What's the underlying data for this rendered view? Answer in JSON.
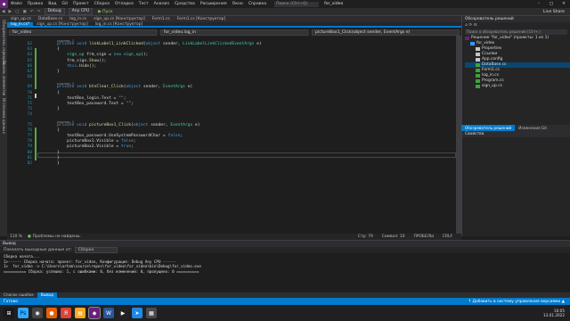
{
  "menu": {
    "items": [
      "Файл",
      "Правка",
      "Вид",
      "Git",
      "Проект",
      "Сборка",
      "Отладка",
      "Тест",
      "Анализ",
      "Средства",
      "Расширения",
      "Окно",
      "Справка"
    ],
    "search_placeholder": "Поиск (Ctrl+Q)",
    "project_title": "for_video"
  },
  "toolbar": {
    "config": "Debug",
    "platform": "Any CPU",
    "start": "▶ Пуск",
    "live_share": "Live Share"
  },
  "left_strip": [
    "Обозреватель серверов",
    "Панель элементов",
    "Источники данных"
  ],
  "tabs_row1": [
    "sign_up.cs",
    "DataBase.cs",
    "log_in.cs",
    "sign_up.cs [Конструктор]",
    "Form1.cs",
    "Form1.cs [Конструктор]"
  ],
  "tabs_row2": [
    "log_in.cs*",
    "sign_up.cs [Конструктор]",
    "log_in.cs [Конструктор]"
  ],
  "navbar": [
    "for_video",
    "for_video.log_in",
    "pictureBox1_Click(object sender, EventArgs e)"
  ],
  "code_lines": [
    {
      "n": "62",
      "ref": "ссылок: 1",
      "text": "private void linkLabel1_LinkClicked(object sender, LinkLabelLinkClickedEventArgs e)"
    },
    {
      "n": "63",
      "text": "{"
    },
    {
      "n": "64",
      "text": "    sign_up frm_sign = new sign_up();"
    },
    {
      "n": "65",
      "text": "    frm_sign.Show();"
    },
    {
      "n": "66",
      "text": "    this.Hide();"
    },
    {
      "n": "67",
      "text": "}"
    },
    {
      "n": "68",
      "text": ""
    },
    {
      "n": "69",
      "ref": "ссылок: 1",
      "text": "private void btnClear_Click(object sender, EventArgs e)"
    },
    {
      "n": "70",
      "text": "{"
    },
    {
      "n": "71",
      "text": "    textBox_login.Text = \"\";"
    },
    {
      "n": "72",
      "text": "    textBox_password.Text = \"\";"
    },
    {
      "n": "73",
      "text": "}"
    },
    {
      "n": "74",
      "text": ""
    },
    {
      "n": "75",
      "ref": "ссылок: 1",
      "text": "private void pictureBox1_Click(object sender, EventArgs e)"
    },
    {
      "n": "76",
      "text": "{"
    },
    {
      "n": "77",
      "text": "    textBox_password.UseSystemPasswordChar = false;"
    },
    {
      "n": "78",
      "text": "    pictureBox1.Visible = false;"
    },
    {
      "n": "79",
      "text": "    pictureBox2.Visible = true;"
    },
    {
      "n": "80",
      "text": "}"
    },
    {
      "n": "81",
      "text": "}"
    },
    {
      "n": "82",
      "text": "}"
    }
  ],
  "editor_status": {
    "zoom": "110 %",
    "issues": "Проблемы не найдены.",
    "line": "Стр: 79",
    "char": "Символ: 10",
    "spaces": "ПРОБЕЛЫ",
    "crlf": "CRLF"
  },
  "solution_explorer": {
    "title": "Обозреватель решений",
    "search_placeholder": "Поиск в обозреватель решений (Ctrl+;)",
    "items": [
      {
        "label": "Решение \"for_video\" (проекты: 1 из 1)",
        "indent": 0,
        "icon": "#68217a"
      },
      {
        "label": "for_video",
        "indent": 1,
        "icon": "#3794ff"
      },
      {
        "label": "Properties",
        "indent": 2,
        "icon": "#c5c5c5"
      },
      {
        "label": "Ссылки",
        "indent": 2,
        "icon": "#c5c5c5"
      },
      {
        "label": "App.config",
        "indent": 2,
        "icon": "#c5c5c5"
      },
      {
        "label": "DataBase.cs",
        "indent": 2,
        "icon": "#3da33d",
        "selected": true
      },
      {
        "label": "Form1.cs",
        "indent": 2,
        "icon": "#3da33d"
      },
      {
        "label": "log_in.cs",
        "indent": 2,
        "icon": "#3da33d"
      },
      {
        "label": "Program.cs",
        "indent": 2,
        "icon": "#3da33d"
      },
      {
        "label": "sign_up.cs",
        "indent": 2,
        "icon": "#3da33d"
      }
    ]
  },
  "right_tabs": [
    "Обозреватель решений",
    "Изменения Git"
  ],
  "properties_title": "Свойства",
  "output": {
    "title": "Вывод",
    "show_from_label": "Показать выходные данные от:",
    "source": "Сборка",
    "lines": [
      "Сборка начата...",
      "1>------ Сборка начата: проект: for_video, Конфигурация: Debug Any CPU ------",
      "1>  for_video -> C:\\Users\\artem\\source\\repos\\for_video\\for_video\\bin\\Debug\\for_video.exe",
      "========== Сборка: успешно: 1, с ошибками: 0, без изменений: 0, пропущено: 0 =========="
    ]
  },
  "bottom_tabs": [
    "Список ошибок",
    "Вывод"
  ],
  "status": {
    "left": "Готово",
    "right": "↑ Добавить в систему управления версиями ▲"
  },
  "clock": {
    "time": "16:05",
    "date": "13.01.2022"
  }
}
